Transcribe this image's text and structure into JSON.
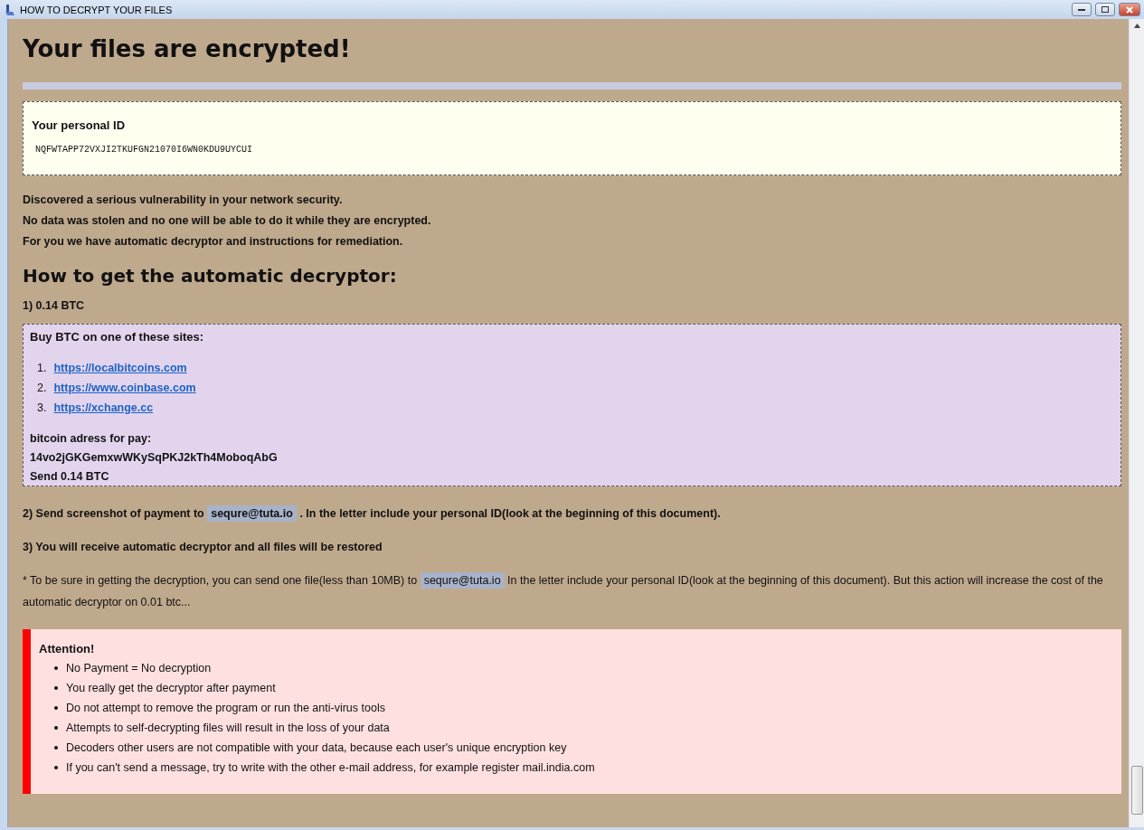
{
  "window": {
    "title": "HOW TO DECRYPT YOUR FILES"
  },
  "heading": "Your files are encrypted!",
  "id_box": {
    "label": "Your personal ID",
    "value": "NQFWTAPP72VXJI2TKUFGN21070I6WN0KDU9UYCUI"
  },
  "intro": [
    "Discovered a serious vulnerability in your network security.",
    "No data was stolen and no one will be able to do it while they are encrypted.",
    "For you we have automatic decryptor and instructions for remediation."
  ],
  "subheading": "How to get the automatic decryptor:",
  "step1": "1) 0.14 BTC",
  "btc_box": {
    "title": "Buy BTC on one of these sites:",
    "sites": [
      {
        "number": "1.",
        "url": "https://localbitcoins.com"
      },
      {
        "number": "2.",
        "url": "https://www.coinbase.com"
      },
      {
        "number": "3.",
        "url": "https://xchange.cc"
      }
    ],
    "address_label": "bitcoin adress for pay:",
    "address": "14vo2jGKGemxwWKySqPKJ2kTh4MoboqAbG",
    "send": "Send 0.14 BTC"
  },
  "step2": {
    "before": "2) Send screenshot of payment to",
    "email": "sequre@tuta.io",
    "after": ". In the letter include your personal ID(look at the beginning of this document)."
  },
  "step3": "3) You will receive automatic decryptor and all files will be restored",
  "note": {
    "before": "* To be sure in getting the decryption, you can send one file(less than 10MB) to",
    "email": "sequre@tuta.io",
    "after": "In the letter include your personal ID(look at the beginning of this document). But this action will increase the cost of the automatic decryptor on 0.01 btc..."
  },
  "attention": {
    "title": "Attention!",
    "items": [
      "No Payment = No decryption",
      "You really get the decryptor after payment",
      "Do not attempt to remove the program or run the anti-virus tools",
      "Attempts to self-decrypting files will result in the loss of your data",
      "Decoders other users are not compatible with your data, because each user's unique encryption key",
      "If you can't send a message, try to write with the other e-mail address, for example register mail.india.com"
    ]
  }
}
